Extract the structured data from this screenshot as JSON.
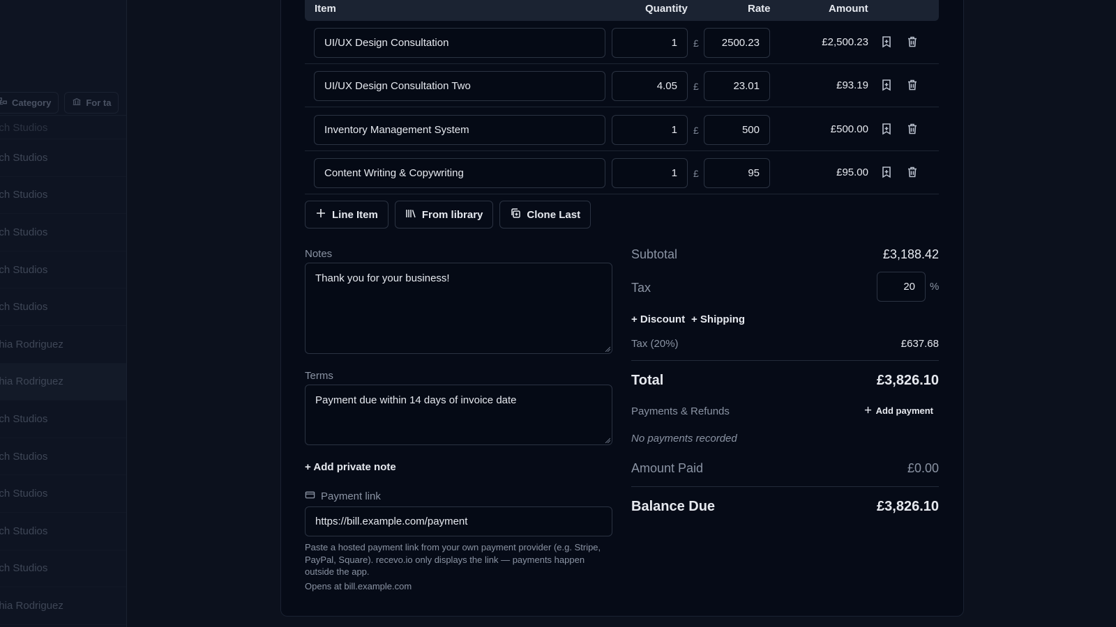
{
  "sidebar": {
    "filters": [
      "Category",
      "For ta"
    ],
    "rows": [
      "ech Studios",
      "ech Studios",
      "ech Studios",
      "ech Studios",
      "ech Studios",
      "ech Studios",
      "phia Rodriguez",
      "phia Rodriguez",
      "ech Studios",
      "ech Studios",
      "ech Studios",
      "ech Studios",
      "ech Studios",
      "phia Rodriguez"
    ]
  },
  "table": {
    "headers": {
      "item": "Item",
      "quantity": "Quantity",
      "rate": "Rate",
      "amount": "Amount"
    },
    "currency_symbol": "£",
    "rows": [
      {
        "name": "UI/UX Design Consultation",
        "quantity": "1",
        "rate": "2500.23",
        "amount": "£2,500.23"
      },
      {
        "name": "UI/UX Design Consultation Two",
        "quantity": "4.05",
        "rate": "23.01",
        "amount": "£93.19"
      },
      {
        "name": "Inventory Management System",
        "quantity": "1",
        "rate": "500",
        "amount": "£500.00"
      },
      {
        "name": "Content Writing & Copywriting",
        "quantity": "1",
        "rate": "95",
        "amount": "£95.00"
      }
    ]
  },
  "actions": {
    "line_item": "Line Item",
    "from_library": "From library",
    "clone_last": "Clone Last"
  },
  "notes": {
    "label": "Notes",
    "value": "Thank you for your business!"
  },
  "terms": {
    "label": "Terms",
    "value": "Payment due within 14 days of invoice date"
  },
  "add_private_note": "+ Add private note",
  "payment_link": {
    "label": "Payment link",
    "value": "https://bill.example.com/payment",
    "help": "Paste a hosted payment link from your own payment provider (e.g. Stripe, PayPal, Square). recevo.io only displays the link — payments happen outside the app.",
    "opens": "Opens at bill.example.com"
  },
  "summary": {
    "subtotal_label": "Subtotal",
    "subtotal": "£3,188.42",
    "tax_label": "Tax",
    "tax_rate": "20",
    "percent": "%",
    "add_discount": "+ Discount",
    "add_shipping": "+ Shipping",
    "tax_line_label": "Tax (20%)",
    "tax_amount": "£637.68",
    "total_label": "Total",
    "total": "£3,826.10",
    "payments_label": "Payments & Refunds",
    "add_payment": "Add payment",
    "no_payments": "No payments recorded",
    "amount_paid_label": "Amount Paid",
    "amount_paid": "£0.00",
    "balance_label": "Balance Due",
    "balance": "£3,826.10"
  }
}
